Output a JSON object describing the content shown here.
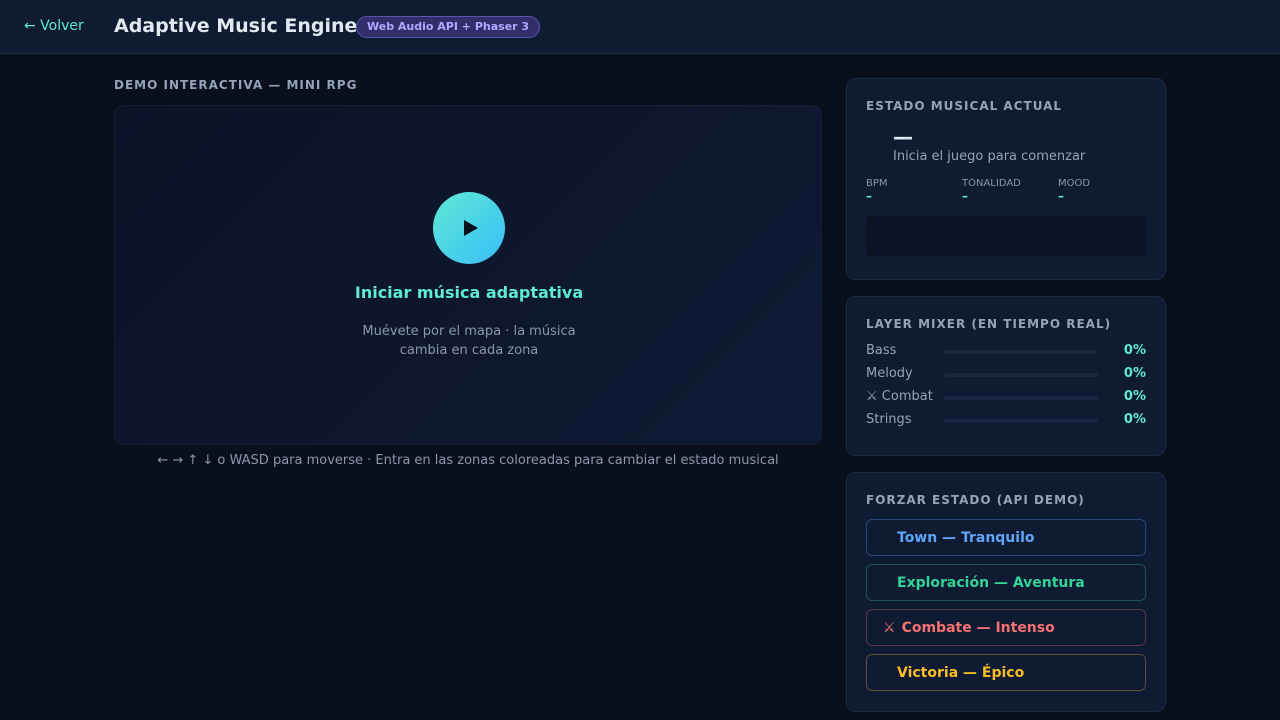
{
  "header": {
    "back_label": "← Volver",
    "title": "Adaptive Music Engine",
    "title_icon": "music-note-icon",
    "badge": "Web Audio API + Phaser 3"
  },
  "demo": {
    "section_label": "DEMO INTERACTIVA — MINI RPG",
    "start_label": "Iniciar música adaptativa",
    "hint_line1": "Muévete por el mapa · la música",
    "hint_line2": "cambia en cada zona",
    "controls_hint": "← → ↑ ↓ o WASD para moverse · Entra en las zonas coloreadas para cambiar el estado musical"
  },
  "state_panel": {
    "title": "ESTADO MUSICAL ACTUAL",
    "state_name": "—",
    "state_desc": "Inicia el juego para comenzar",
    "stats": [
      {
        "label": "BPM",
        "value": "–"
      },
      {
        "label": "TONALIDAD",
        "value": "–"
      },
      {
        "label": "MOOD",
        "value": "–"
      }
    ]
  },
  "mixer": {
    "title": "LAYER MIXER (EN TIEMPO REAL)",
    "layers": [
      {
        "icon": "drum-icon",
        "glyph": "",
        "name": "Bass",
        "value": "0%",
        "level": 0
      },
      {
        "icon": "music-note-icon",
        "glyph": "",
        "name": "Melody",
        "value": "0%",
        "level": 0
      },
      {
        "icon": "crossed-swords-icon",
        "glyph": "⚔",
        "name": "Combat",
        "value": "0%",
        "level": 0
      },
      {
        "icon": "violin-icon",
        "glyph": "",
        "name": "Strings",
        "value": "0%",
        "level": 0
      }
    ]
  },
  "force": {
    "title": "FORZAR ESTADO (API DEMO)",
    "buttons": [
      {
        "icon": "house-icon",
        "glyph": "",
        "label": "Town — Tranquilo",
        "color": "#60a5fa"
      },
      {
        "icon": "compass-icon",
        "glyph": "",
        "label": "Exploración — Aventura",
        "color": "#34d399"
      },
      {
        "icon": "crossed-swords-icon",
        "glyph": "⚔",
        "label": "Combate — Intenso",
        "color": "#f87171"
      },
      {
        "icon": "trophy-icon",
        "glyph": "",
        "label": "Victoria — Épico",
        "color": "#fbbf24"
      }
    ]
  },
  "colors": {
    "accent": "#5eead4",
    "background": "#0a0f1c",
    "panel": "#0f1a33"
  }
}
